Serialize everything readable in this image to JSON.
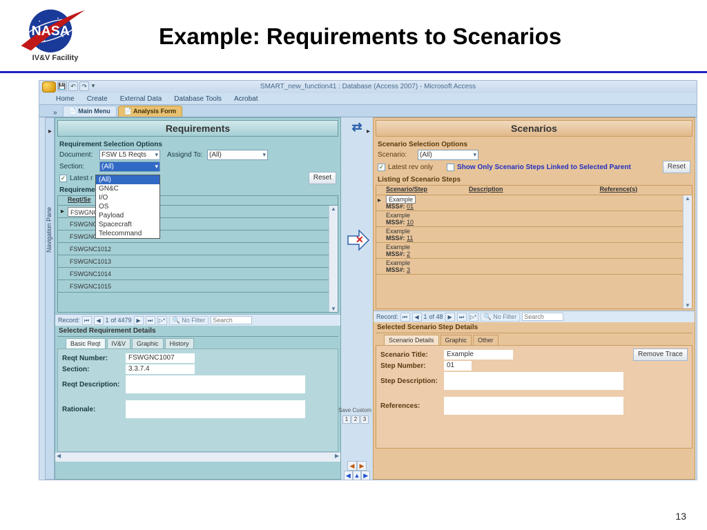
{
  "slide": {
    "title": "Example: Requirements to Scenarios",
    "facility": "IV&V Facility",
    "page_number": "13"
  },
  "app": {
    "window_title": "SMART_new_function41 : Database (Access 2007) - Microsoft Access",
    "ribbon_tabs": [
      "Home",
      "Create",
      "External Data",
      "Database Tools",
      "Acrobat"
    ],
    "doc_tabs": {
      "main": "Main Menu",
      "active": "Analysis Form"
    },
    "nav_pane_label": "Navigation Pane"
  },
  "requirements": {
    "title": "Requirements",
    "opts_heading": "Requirement Selection Options",
    "document_label": "Document:",
    "document_value": "FSW L5 Reqts",
    "assigned_label": "Assignd To:",
    "assigned_value": "(All)",
    "section_label": "Section:",
    "section_value": "(All)",
    "latest_only_label": "Latest r",
    "reset_label": "Reset",
    "section_dropdown_options": [
      "(All)",
      "GN&C",
      "I/O",
      "OS",
      "Payload",
      "Spacecraft",
      "Telecommand"
    ],
    "list_heading": "Requirement",
    "list_cols": [
      "Reqt/Se"
    ],
    "rows": [
      "FSWGNC",
      "FSWGNC",
      "FSWGNC1011",
      "FSWGNC1012",
      "FSWGNC1013",
      "FSWGNC1014",
      "FSWGNC1015"
    ],
    "record_nav": {
      "label": "Record:",
      "index": "1",
      "count": "of 4479",
      "filter": "No Filter",
      "search": "Search"
    },
    "details": {
      "heading": "Selected Requirement Details",
      "tabs": [
        "Basic Reqt",
        "IV&V",
        "Graphic",
        "History"
      ],
      "reqt_number_label": "Reqt Number:",
      "reqt_number_value": "FSWGNC1007",
      "section_label": "Section:",
      "section_value": "3.3.7.4",
      "desc_label": "Reqt Description:",
      "rationale_label": "Rationale:"
    }
  },
  "scenarios": {
    "title": "Scenarios",
    "opts_heading": "Scenario Selection Options",
    "scenario_label": "Scenario:",
    "scenario_value": "(All)",
    "latest_only_label": "Latest rev only",
    "show_only_label": "Show Only Scenario Steps Linked to Selected Parent",
    "reset_label": "Reset",
    "list_heading": "Listing of Scenario Steps",
    "list_cols": [
      "Scenario/Step",
      "Description",
      "Reference(s)"
    ],
    "rows": [
      {
        "name": "Example",
        "mss": "01"
      },
      {
        "name": "Example",
        "mss": "10"
      },
      {
        "name": "Example",
        "mss": "11"
      },
      {
        "name": "Example",
        "mss": "2"
      },
      {
        "name": "Example",
        "mss": "3"
      }
    ],
    "mss_label": "MSS#:",
    "record_nav": {
      "label": "Record:",
      "index": "1",
      "count": "of 48",
      "filter": "No Filter",
      "search": "Search"
    },
    "details": {
      "heading": "Selected Scenario Step Details",
      "tabs": [
        "Scenario Details",
        "Graphic",
        "Other"
      ],
      "title_label": "Scenario Title:",
      "title_value": "Example",
      "step_label": "Step Number:",
      "step_value": "01",
      "desc_label": "Step Description:",
      "refs_label": "References:",
      "remove_trace_label": "Remove Trace"
    }
  },
  "mid": {
    "save_label": "Save Custom"
  }
}
